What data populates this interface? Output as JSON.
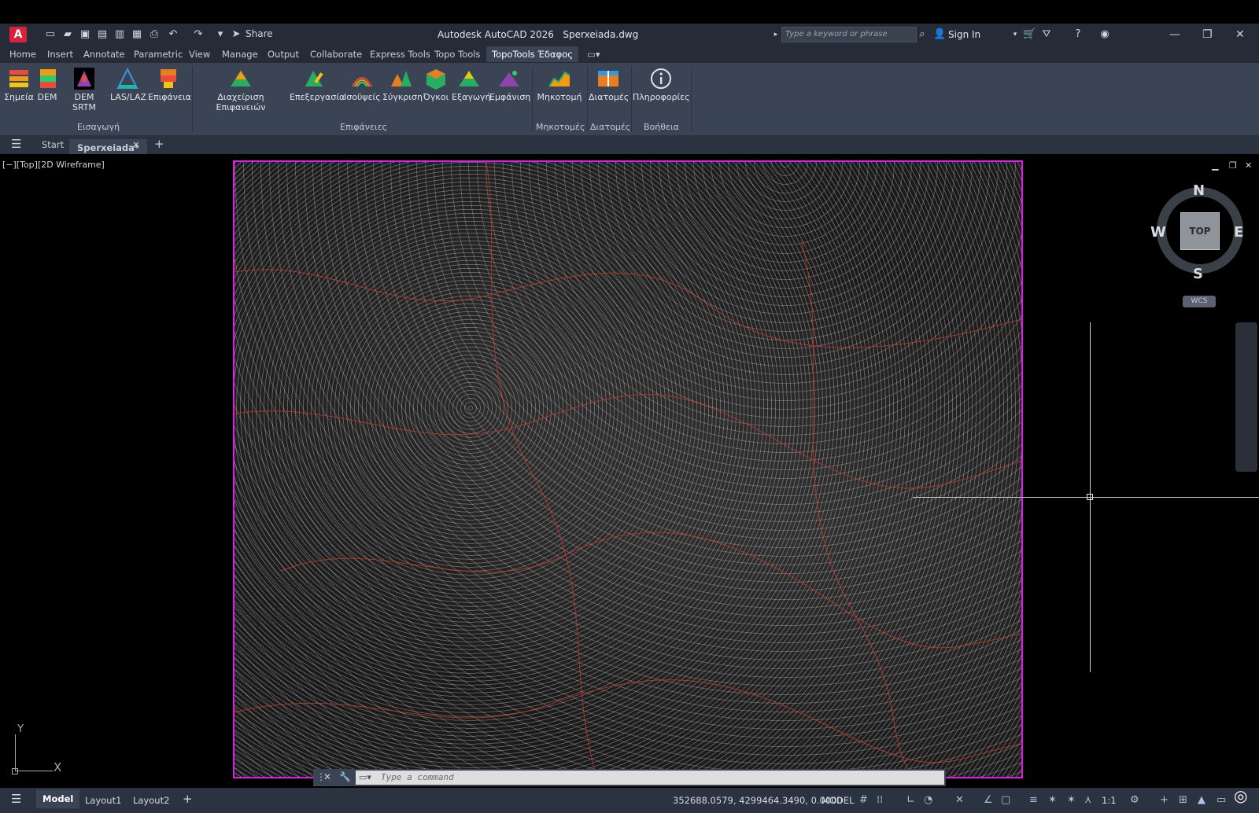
{
  "window": {
    "app_title": "Autodesk AutoCAD 2026",
    "file_name": "Sperxeiada.dwg"
  },
  "titlebar": {
    "app_button_label": "A",
    "share_label": "Share",
    "search_placeholder": "Type a keyword or phrase",
    "signin_label": "Sign In"
  },
  "ribbon_tabs": [
    "Home",
    "Insert",
    "Annotate",
    "Parametric",
    "View",
    "Manage",
    "Output",
    "Collaborate",
    "Express Tools",
    "Topo Tools",
    "TopoTools Έδαφος"
  ],
  "ribbon": {
    "buttons": [
      "Σημεία",
      "DEM",
      "DEM SRTM",
      "LAS/LAZ",
      "Επιφάνεια",
      "Διαχείριση Επιφανειών",
      "Επεξεργασία",
      "Ισοϋψείς",
      "Σύγκριση",
      "Όγκοι",
      "Εξαγωγή",
      "Εμφάνιση",
      "Μηκοτομή",
      "Διατομές",
      "Πληροφορίες"
    ],
    "panels": [
      "Εισαγωγή",
      "Επιφάνειες",
      "Μηκοτομές",
      "Διατομές",
      "Βοήθεια"
    ]
  },
  "file_tabs": {
    "start": "Start",
    "current": "Sperxeiada*"
  },
  "viewport": {
    "label": "[−][Top][2D Wireframe]"
  },
  "viewcube": {
    "n": "N",
    "s": "S",
    "e": "E",
    "w": "W",
    "top": "TOP",
    "wcs": "WCS"
  },
  "ucs": {
    "x": "X",
    "y": "Y"
  },
  "command_line": {
    "placeholder": "Type a command"
  },
  "status": {
    "layouts": [
      "Model",
      "Layout1",
      "Layout2"
    ],
    "coordinates": "352688.0579, 4299464.3490, 0.0000",
    "mode": "MODEL",
    "scale": "1:1"
  },
  "colors": {
    "viewport_border": "#e31be8",
    "contour_major": "#c0392b",
    "accent": "#d7233a"
  }
}
